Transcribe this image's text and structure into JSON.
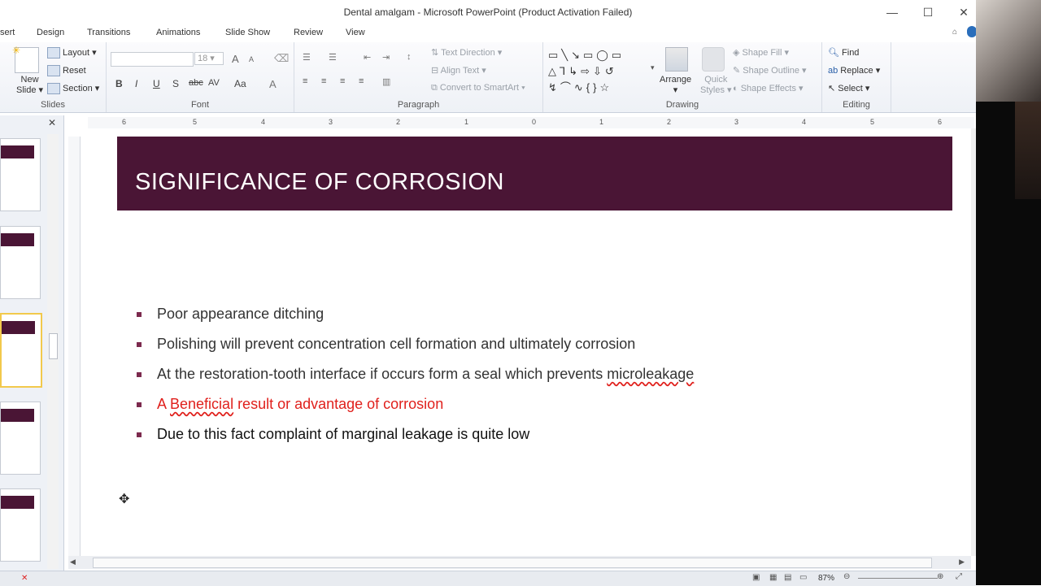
{
  "window": {
    "title": "Dental amalgam  -  Microsoft PowerPoint (Product Activation Failed)",
    "minimize": "—",
    "maximize": "☐",
    "close": "✕"
  },
  "tabs": [
    "sert",
    "Design",
    "Transitions",
    "Animations",
    "Slide Show",
    "Review",
    "View"
  ],
  "ribbon": {
    "slides": {
      "new_slide": "New",
      "new_slide_line2": "Slide",
      "layout": "Layout",
      "reset": "Reset",
      "section": "Section",
      "label": "Slides"
    },
    "font": {
      "font_name": "",
      "font_size": "18",
      "bold": "B",
      "italic": "I",
      "underline": "U",
      "shadow": "S",
      "strike": "abc",
      "spacing": "AV",
      "case": "Aa",
      "color": "A",
      "grow": "A",
      "shrink": "A",
      "label": "Font"
    },
    "paragraph": {
      "text_direction": "Text Direction",
      "align_text": "Align Text",
      "convert_smartart": "Convert to SmartArt",
      "label": "Paragraph"
    },
    "drawing": {
      "arrange": "Arrange",
      "quick_styles": "Quick",
      "quick_styles_line2": "Styles",
      "shape_fill": "Shape Fill",
      "shape_outline": "Shape Outline",
      "shape_effects": "Shape Effects",
      "label": "Drawing"
    },
    "editing": {
      "find": "Find",
      "replace": "Replace",
      "select": "Select",
      "label": "Editing"
    }
  },
  "ruler": {
    "marks": [
      "6",
      "5",
      "4",
      "3",
      "2",
      "1",
      "0",
      "1",
      "2",
      "3",
      "4",
      "5",
      "6"
    ]
  },
  "slide": {
    "title": "SIGNIFICANCE OF CORROSION",
    "bullets": [
      "Poor appearance ditching",
      "Polishing will prevent concentration cell formation and ultimately corrosion",
      "At the restoration-tooth interface if occurs form a seal which prevents ",
      "A ",
      "Due to this fact complaint of marginal leakage is quite low"
    ],
    "bullet3_misspelled": "microleakage",
    "bullet4_misspelled": "Beneficial",
    "bullet4_rest": " result or advantage of corrosion"
  },
  "status": {
    "zoom": "87%"
  },
  "colors": {
    "title_band": "#4a1535",
    "bullet_marker": "#7c2a4e",
    "highlight_text": "#e0201c"
  }
}
